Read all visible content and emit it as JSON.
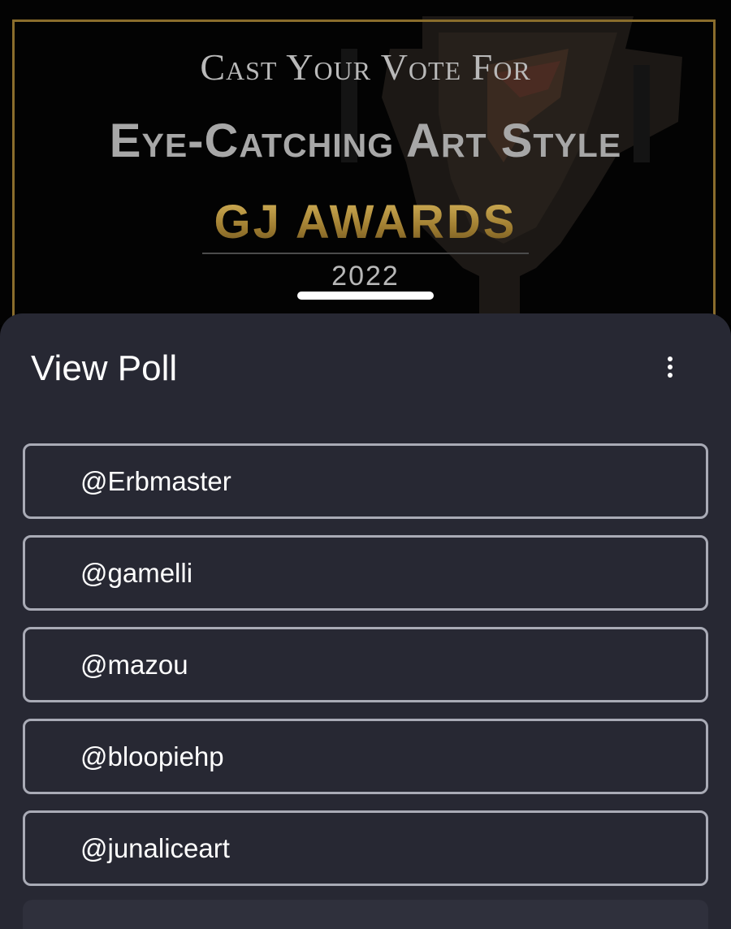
{
  "banner": {
    "subtitle": "Cast Your Vote For",
    "title": "Eye-Catching Art Style",
    "awards": "GJ AWARDS",
    "year": "2022",
    "frame_color": "#8a6d2c",
    "gold_color": "#b5933f"
  },
  "sheet": {
    "title": "View Poll",
    "menu_icon": "more-vertical-icon",
    "background_color": "#272833",
    "options": [
      {
        "label": "@Erbmaster"
      },
      {
        "label": "@gamelli"
      },
      {
        "label": "@mazou"
      },
      {
        "label": "@bloopiehp"
      },
      {
        "label": "@junaliceart"
      }
    ]
  }
}
